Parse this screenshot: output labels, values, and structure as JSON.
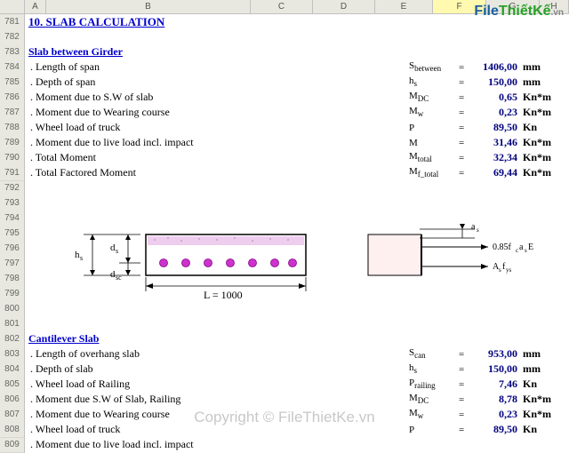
{
  "logo": {
    "part1": "File",
    "part2": "ThiếtKế",
    "part3": ".vn"
  },
  "watermark": "Copyright © FileThietKe.vn",
  "section_title": "10. SLAB CALCULATION",
  "section1": {
    "heading": "Slab between Girder",
    "rows": [
      {
        "label": ". Length of span",
        "sym": "S<sub>between</sub>",
        "val": "1406,00",
        "unit": "mm"
      },
      {
        "label": ". Depth of span",
        "sym": "h<sub>s</sub>",
        "val": "150,00",
        "unit": "mm"
      },
      {
        "label": ". Moment due to S.W of slab",
        "sym": "M<sub>DC</sub>",
        "val": "0,65",
        "unit": "Kn*m"
      },
      {
        "label": ". Moment due to Wearing course",
        "sym": "M<sub>w</sub>",
        "val": "0,23",
        "unit": "Kn*m"
      },
      {
        "label": ". Wheel load of truck",
        "sym": "P",
        "val": "89,50",
        "unit": "Kn"
      },
      {
        "label": ". Moment due to live load incl. impact",
        "sym": "M",
        "val": "31,46",
        "unit": "Kn*m"
      },
      {
        "label": ". Total Moment",
        "sym": "M<sub>total</sub>",
        "val": "32,34",
        "unit": "Kn*m"
      },
      {
        "label": ". Total Factored Moment",
        "sym": "M<sub>f_total</sub>",
        "val": "69,44",
        "unit": "Kn*m"
      }
    ]
  },
  "diagram": {
    "hs": "h",
    "ds": "d",
    "dsc": "d",
    "L": "L = 1000",
    "as": "a",
    "eq1": "0.85f",
    "eq1b": "a",
    "eq1c": "E",
    "eq2": "A",
    "eq2b": "f"
  },
  "section2": {
    "heading": "Cantilever Slab",
    "rows": [
      {
        "label": ". Length of overhang slab",
        "sym": "S<sub>can</sub>",
        "val": "953,00",
        "unit": "mm"
      },
      {
        "label": ". Depth of slab",
        "sym": "h<sub>s</sub>",
        "val": "150,00",
        "unit": "mm"
      },
      {
        "label": ". Wheel load of Railing",
        "sym": "P<sub>railing</sub>",
        "val": "7,46",
        "unit": "Kn"
      },
      {
        "label": ". Moment due S.W of Slab, Railing",
        "sym": "M<sub>DC</sub>",
        "val": "8,78",
        "unit": "Kn*m"
      },
      {
        "label": ". Moment due to Wearing course",
        "sym": "M<sub>w</sub>",
        "val": "0,23",
        "unit": "Kn*m"
      },
      {
        "label": ". Wheel load of truck",
        "sym": "P",
        "val": "89,50",
        "unit": "Kn"
      },
      {
        "label": ". Moment due to live load incl. impact",
        "sym": "",
        "val": "",
        "unit": ""
      }
    ]
  },
  "row_start": 781,
  "col_letters": [
    "A",
    "B",
    "C",
    "D",
    "E",
    "F",
    "G",
    "H"
  ]
}
